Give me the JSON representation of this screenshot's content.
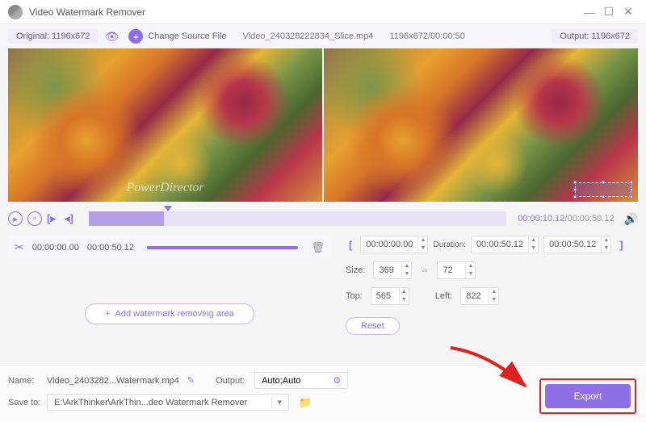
{
  "title": "Video Watermark Remover",
  "topbar": {
    "original": "Original: 1196x672",
    "change_src": "Change Source File",
    "file": "Video_240328222834_Slice.mp4",
    "dims": "1196x672/00:00:50",
    "output": "Output: 1196x672"
  },
  "preview": {
    "watermark_text": "PowerDirector"
  },
  "controls": {
    "cur_time": "00:00:10.12",
    "total_time": "/00:00:50.12"
  },
  "segment": {
    "start": "00:00:00.00",
    "end": "00:00:50.12"
  },
  "range": {
    "start": "00:00:00.00",
    "dur_label": "Duration:",
    "dur": "00:00:50.12",
    "end": "00:00:50.12"
  },
  "size": {
    "label": "Size:",
    "w": "369",
    "h": "72"
  },
  "pos": {
    "top_label": "Top:",
    "top": "565",
    "left_label": "Left:",
    "left": "822"
  },
  "buttons": {
    "reset": "Reset",
    "add_wm": "Add watermark removing area",
    "export": "Export"
  },
  "bottom": {
    "name_label": "Name:",
    "name": "Video_2403282...Watermark.mp4",
    "output_label": "Output:",
    "output_val": "Auto;Auto",
    "save_label": "Save to:",
    "save_path": "E:\\ArkThinker\\ArkThin...deo Watermark Remover"
  }
}
